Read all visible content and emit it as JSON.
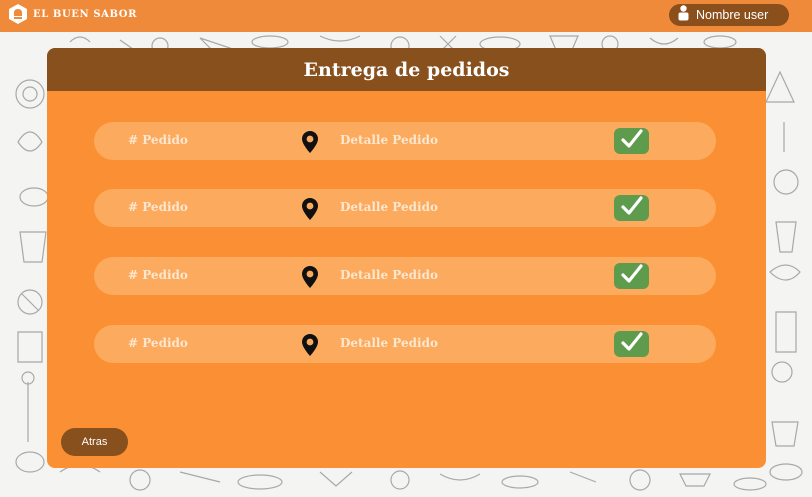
{
  "topbar": {
    "brand_name": "EL BUEN SABOR",
    "brand_icon": "chef-hat-icon",
    "user_icon": "user-icon",
    "user_name": "Nombre user"
  },
  "panel": {
    "title": "Entrega de pedidos",
    "orders": [
      {
        "number_label": "# Pedido",
        "detail_label": "Detalle Pedido",
        "location_icon": "map-pin-icon",
        "confirm_icon": "checkmark-icon"
      },
      {
        "number_label": "# Pedido",
        "detail_label": "Detalle Pedido",
        "location_icon": "map-pin-icon",
        "confirm_icon": "checkmark-icon"
      },
      {
        "number_label": "# Pedido",
        "detail_label": "Detalle Pedido",
        "location_icon": "map-pin-icon",
        "confirm_icon": "checkmark-icon"
      },
      {
        "number_label": "# Pedido",
        "detail_label": "Detalle Pedido",
        "location_icon": "map-pin-icon",
        "confirm_icon": "checkmark-icon"
      }
    ],
    "back_label": "Atras"
  },
  "colors": {
    "topbar": "#ef8a3a",
    "panel": "#fb8f33",
    "panel_header": "#87501d",
    "row": "#fcaa5e",
    "confirm": "#5f9b4c"
  }
}
